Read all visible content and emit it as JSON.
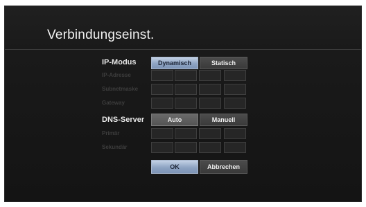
{
  "dialog": {
    "title": "Verbindungseinst."
  },
  "ip_mode": {
    "label": "IP-Modus",
    "options": [
      "Dynamisch",
      "Statisch"
    ],
    "selected": "Dynamisch"
  },
  "fields": {
    "ip_address": "IP-Adresse",
    "subnet_mask": "Subnetmaske",
    "gateway": "Gateway",
    "primary": "Primär",
    "secondary": "Sekundär"
  },
  "dns": {
    "label": "DNS-Server",
    "options": [
      "Auto",
      "Manuell"
    ],
    "selected": "Auto"
  },
  "actions": {
    "ok": "OK",
    "cancel": "Abbrechen"
  },
  "colors": {
    "panel_bg": "#1a1a1a",
    "selected_button": "#8ea4c3",
    "normal_button": "#3a3a3a"
  }
}
